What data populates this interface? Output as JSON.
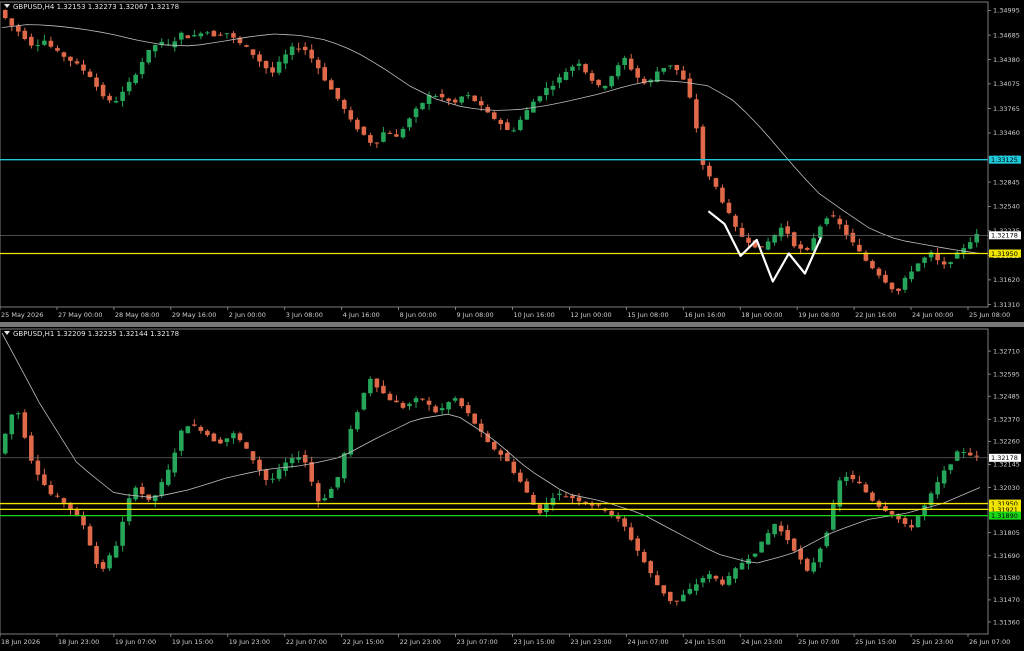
{
  "colors": {
    "background": "#000000",
    "bull": "#26a65b",
    "bear": "#e0694a",
    "ma": "#bfbfbf",
    "resistance": "#1ec8d8",
    "support_yellow": "#f2e600",
    "support_green": "#19d819",
    "price_line": "#7a7a7a",
    "pattern": "#ffffff"
  },
  "chart_data": [
    {
      "type": "candlestick",
      "title": "GBPUSD,H4  1.32153 1.32273 1.32067 1.32178",
      "symbol": "GBPUSD",
      "timeframe": "H4",
      "ohlc": {
        "open": 1.32153,
        "high": 1.32273,
        "low": 1.32067,
        "close": 1.32178
      },
      "ylim": [
        1.3128,
        1.351
      ],
      "y_ticks": [
        "1.34995",
        "1.34685",
        "1.34380",
        "1.34075",
        "1.33765",
        "1.33460",
        "1.33150",
        "1.32845",
        "1.32540",
        "1.32235",
        "1.31925",
        "1.31620",
        "1.31310"
      ],
      "x_ticks": [
        "25 May 2026",
        "27 May 00:00",
        "28 May 08:00",
        "29 May 16:00",
        "2 Jun 00:00",
        "3 Jun 08:00",
        "4 Jun 16:00",
        "8 Jun 00:00",
        "9 Jun 08:00",
        "10 Jun 16:00",
        "12 Jun 00:00",
        "15 Jun 08:00",
        "16 Jun 16:00",
        "18 Jun 00:00",
        "19 Jun 08:00",
        "22 Jun 16:00",
        "24 Jun 00:00",
        "25 Jun 08:00"
      ],
      "levels": [
        {
          "value": 1.33125,
          "label": "1.33125",
          "color": "#1ec8d8"
        },
        {
          "value": 1.3195,
          "label": "1.31950",
          "color": "#f2e600"
        }
      ],
      "current_price": {
        "value": 1.32178,
        "label": "1.32178"
      },
      "price_path": [
        1.35,
        1.3482,
        1.347,
        1.3455,
        1.3462,
        1.3448,
        1.344,
        1.343,
        1.3418,
        1.3395,
        1.3382,
        1.3398,
        1.342,
        1.3445,
        1.346,
        1.3455,
        1.347,
        1.3465,
        1.3475,
        1.3468,
        1.3472,
        1.346,
        1.345,
        1.3435,
        1.342,
        1.344,
        1.3455,
        1.345,
        1.343,
        1.3405,
        1.3385,
        1.336,
        1.3345,
        1.333,
        1.335,
        1.334,
        1.3362,
        1.338,
        1.3395,
        1.339,
        1.3382,
        1.3395,
        1.3385,
        1.337,
        1.336,
        1.3345,
        1.3365,
        1.3385,
        1.34,
        1.341,
        1.3425,
        1.3435,
        1.3415,
        1.34,
        1.342,
        1.344,
        1.3418,
        1.3405,
        1.3425,
        1.3432,
        1.342,
        1.338,
        1.33,
        1.328,
        1.325,
        1.322,
        1.321,
        1.32,
        1.3215,
        1.323,
        1.3205,
        1.3195,
        1.3225,
        1.3245,
        1.323,
        1.321,
        1.319,
        1.3175,
        1.316,
        1.3145,
        1.317,
        1.3185,
        1.3195,
        1.3178,
        1.319,
        1.3205,
        1.3218
      ],
      "ma_path": [
        1.3478,
        1.3482,
        1.348,
        1.3476,
        1.347,
        1.3462,
        1.3456,
        1.3455,
        1.346,
        1.3466,
        1.347,
        1.3468,
        1.3462,
        1.3448,
        1.3428,
        1.3405,
        1.3388,
        1.3378,
        1.3374,
        1.3375,
        1.338,
        1.3387,
        1.3395,
        1.3405,
        1.3412,
        1.341,
        1.3405,
        1.3385,
        1.335,
        1.331,
        1.3272,
        1.3248,
        1.3225,
        1.3212,
        1.3206,
        1.32,
        1.3195
      ],
      "pattern_path": [
        1.3248,
        1.3232,
        1.3192,
        1.3212,
        1.316,
        1.3195,
        1.317,
        1.3215
      ],
      "annotations": [
        "double-bottom zigzag drawn in white near 24-25 Jun"
      ]
    },
    {
      "type": "candlestick",
      "title": "GBPUSD,H1  1.32209 1.32235 1.32144 1.32178",
      "symbol": "GBPUSD",
      "timeframe": "H1",
      "ohlc": {
        "open": 1.32209,
        "high": 1.32235,
        "low": 1.32144,
        "close": 1.32178
      },
      "ylim": [
        1.313,
        1.3282
      ],
      "y_ticks": [
        "1.32710",
        "1.32595",
        "1.32485",
        "1.32370",
        "1.32260",
        "1.32145",
        "1.32030",
        "1.31920",
        "1.31805",
        "1.31690",
        "1.31580",
        "1.31470",
        "1.31360"
      ],
      "x_ticks": [
        "18 Jun 2026",
        "18 Jun 23:00",
        "19 Jun 07:00",
        "19 Jun 15:00",
        "19 Jun 23:00",
        "22 Jun 07:00",
        "22 Jun 15:00",
        "22 Jun 23:00",
        "23 Jun 07:00",
        "23 Jun 15:00",
        "23 Jun 23:00",
        "24 Jun 07:00",
        "24 Jun 15:00",
        "24 Jun 23:00",
        "25 Jun 07:00",
        "25 Jun 15:00",
        "25 Jun 23:00",
        "26 Jun 07:00"
      ],
      "levels": [
        {
          "value": 1.3195,
          "label": "1.31950",
          "color": "#f2e600"
        },
        {
          "value": 1.31921,
          "label": "1.31921",
          "color": "#f2e600"
        },
        {
          "value": 1.3189,
          "label": "1.31890",
          "color": "#19d819"
        }
      ],
      "current_price": {
        "value": 1.32178,
        "label": "1.32178"
      },
      "price_path": [
        1.322,
        1.3245,
        1.3215,
        1.32,
        1.3195,
        1.3185,
        1.316,
        1.3175,
        1.3205,
        1.3195,
        1.321,
        1.3235,
        1.3232,
        1.3225,
        1.323,
        1.3218,
        1.3205,
        1.3215,
        1.322,
        1.3195,
        1.3205,
        1.3235,
        1.3258,
        1.3248,
        1.3243,
        1.3248,
        1.324,
        1.3248,
        1.3238,
        1.3225,
        1.3218,
        1.3205,
        1.319,
        1.32,
        1.3198,
        1.3195,
        1.3192,
        1.3185,
        1.317,
        1.3155,
        1.3145,
        1.3152,
        1.316,
        1.3155,
        1.3165,
        1.3172,
        1.3185,
        1.3175,
        1.316,
        1.3178,
        1.321,
        1.3205,
        1.3195,
        1.319,
        1.3182,
        1.3195,
        1.321,
        1.3222,
        1.3218
      ],
      "ma_path": [
        1.328,
        1.3245,
        1.3215,
        1.32,
        1.3198,
        1.3202,
        1.3208,
        1.3212,
        1.3214,
        1.3218,
        1.3228,
        1.3237,
        1.324,
        1.3228,
        1.3212,
        1.32,
        1.3196,
        1.319,
        1.318,
        1.317,
        1.3165,
        1.317,
        1.318,
        1.3187,
        1.319,
        1.3195,
        1.3203
      ]
    }
  ]
}
